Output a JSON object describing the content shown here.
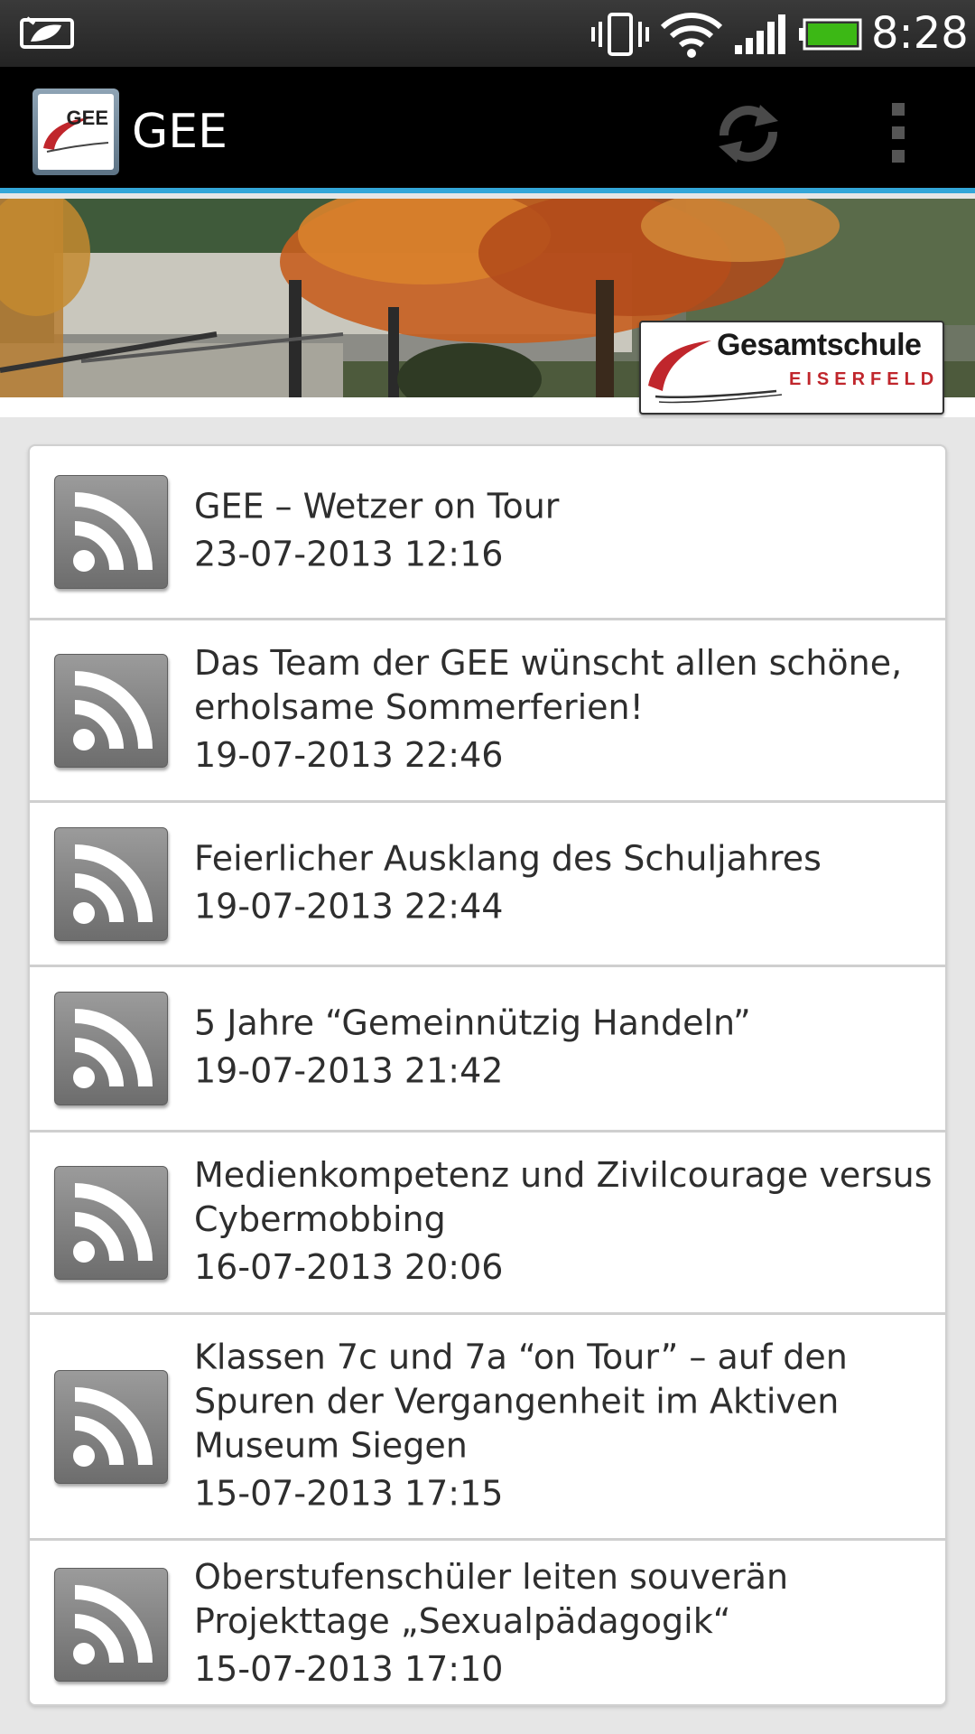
{
  "status_bar": {
    "time": "8:28",
    "icons": [
      "notification-leaf-icon",
      "vibrate-icon",
      "wifi-icon",
      "signal-icon",
      "battery-icon"
    ],
    "battery_color": "#3cb815"
  },
  "action_bar": {
    "app_icon_text": "GEE",
    "title": "GEE",
    "actions": [
      "refresh-icon",
      "overflow-menu-icon"
    ],
    "accent_color": "#33a6d8"
  },
  "banner": {
    "logo_name": "Gesamtschule",
    "logo_sub": "EISERFELD"
  },
  "feed": {
    "item_icon": "rss-feed-icon",
    "items": [
      {
        "title": "GEE – Wetzer on Tour",
        "date": "23-07-2013 12:16"
      },
      {
        "title": "Das Team der GEE wünscht allen schöne, erholsame Sommerferien!",
        "date": "19-07-2013 22:46"
      },
      {
        "title": "Feierlicher Ausklang des Schuljahres",
        "date": "19-07-2013 22:44"
      },
      {
        "title": "5 Jahre “Gemeinnützig Handeln”",
        "date": "19-07-2013 21:42"
      },
      {
        "title": "Medienkompetenz und Zivilcourage versus Cybermobbing",
        "date": "16-07-2013 20:06"
      },
      {
        "title": "Klassen 7c und 7a “on Tour” – auf den Spuren der Vergangenheit im Aktiven Museum Siegen",
        "date": "15-07-2013 17:15"
      },
      {
        "title": "Oberstufenschüler leiten souverän Projekttage „Sexualpädagogik“",
        "date": "15-07-2013 17:10"
      }
    ]
  }
}
